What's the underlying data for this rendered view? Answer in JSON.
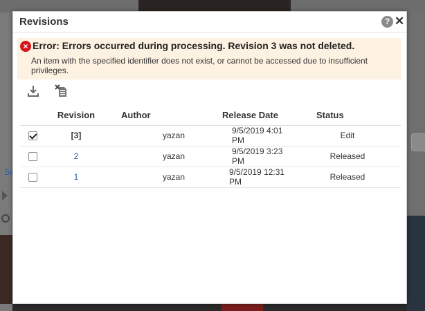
{
  "background": {
    "left_text": "Se"
  },
  "dialog": {
    "title": "Revisions",
    "help_label": "?",
    "close_label": "✕"
  },
  "error": {
    "icon_glyph": "×",
    "title": "Error: Errors occurred during processing. Revision 3 was not deleted.",
    "detail": "An item with the specified identifier does not exist, or cannot be accessed due to insufficient privileges."
  },
  "toolbar": {
    "download_icon": "download-icon",
    "delete_icon": "delete-icon"
  },
  "table": {
    "headers": {
      "revision": "Revision",
      "author": "Author",
      "release_date": "Release Date",
      "status": "Status"
    },
    "rows": [
      {
        "checked": true,
        "revision": "[3]",
        "current": true,
        "author": "yazan",
        "release_date": "9/5/2019 4:01 PM",
        "status": "Edit"
      },
      {
        "checked": false,
        "revision": "2",
        "current": false,
        "author": "yazan",
        "release_date": "9/5/2019 3:23 PM",
        "status": "Released"
      },
      {
        "checked": false,
        "revision": "1",
        "current": false,
        "author": "yazan",
        "release_date": "9/5/2019 12:31 PM",
        "status": "Released"
      }
    ]
  },
  "colors": {
    "error_bg": "#fdf1e1",
    "error_icon": "#d4161c",
    "link": "#2a5ea8"
  }
}
